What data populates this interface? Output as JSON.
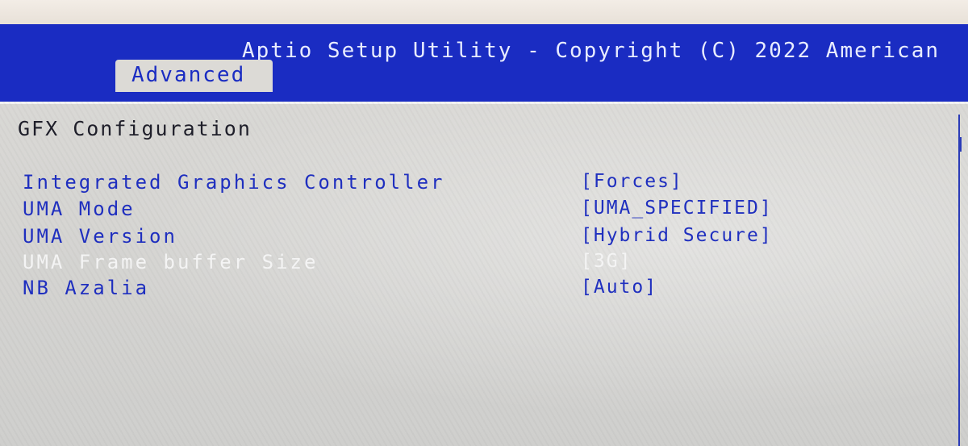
{
  "header": {
    "title": "Aptio Setup Utility - Copyright (C) 2022 American",
    "active_tab": "Advanced"
  },
  "section": {
    "title": "GFX Configuration"
  },
  "settings": [
    {
      "label": "Integrated Graphics Controller",
      "value": "[Forces]",
      "enabled": true
    },
    {
      "label": "UMA Mode",
      "value": "[UMA_SPECIFIED]",
      "enabled": true
    },
    {
      "label": "UMA Version",
      "value": "[Hybrid Secure]",
      "enabled": true
    },
    {
      "label": "UMA Frame buffer Size",
      "value": "[3G]",
      "enabled": false
    },
    {
      "label": "NB Azalia",
      "value": "[Auto]",
      "enabled": true
    }
  ],
  "colors": {
    "header_blue": "#1a2cc2",
    "item_blue": "#1f2fbf",
    "panel_gray": "#d6d6d4",
    "disabled_white": "#f4f4f4"
  }
}
